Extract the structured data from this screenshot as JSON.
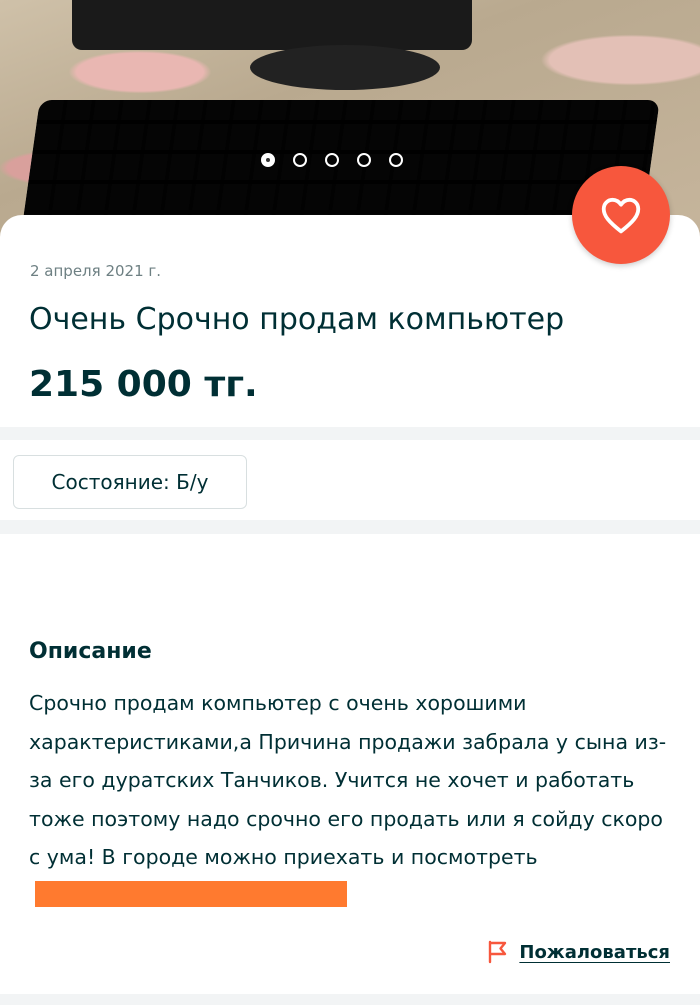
{
  "gallery": {
    "total": 5,
    "active": 0
  },
  "listing": {
    "date": "2 апреля 2021 г.",
    "title": "Очень Срочно продам компьютер",
    "price": "215 000 тг."
  },
  "params": {
    "condition": "Состояние: Б/у"
  },
  "description": {
    "heading": "Описание",
    "text": "Срочно продам компьютер с очень хорошими характеристиками,а Причина продажи забрала у сына из-за его дуратских Танчиков. Учится не хочет и работать тоже поэтому надо срочно его продать или я сойду скоро с ума! В городе можно приехать и посмотреть"
  },
  "actions": {
    "report_label": "Пожаловаться"
  },
  "colors": {
    "accent": "#f7573d",
    "text": "#002f34",
    "redaction": "#ff7a2f"
  },
  "icons": {
    "favorite": "heart-icon",
    "report": "flag-icon"
  }
}
